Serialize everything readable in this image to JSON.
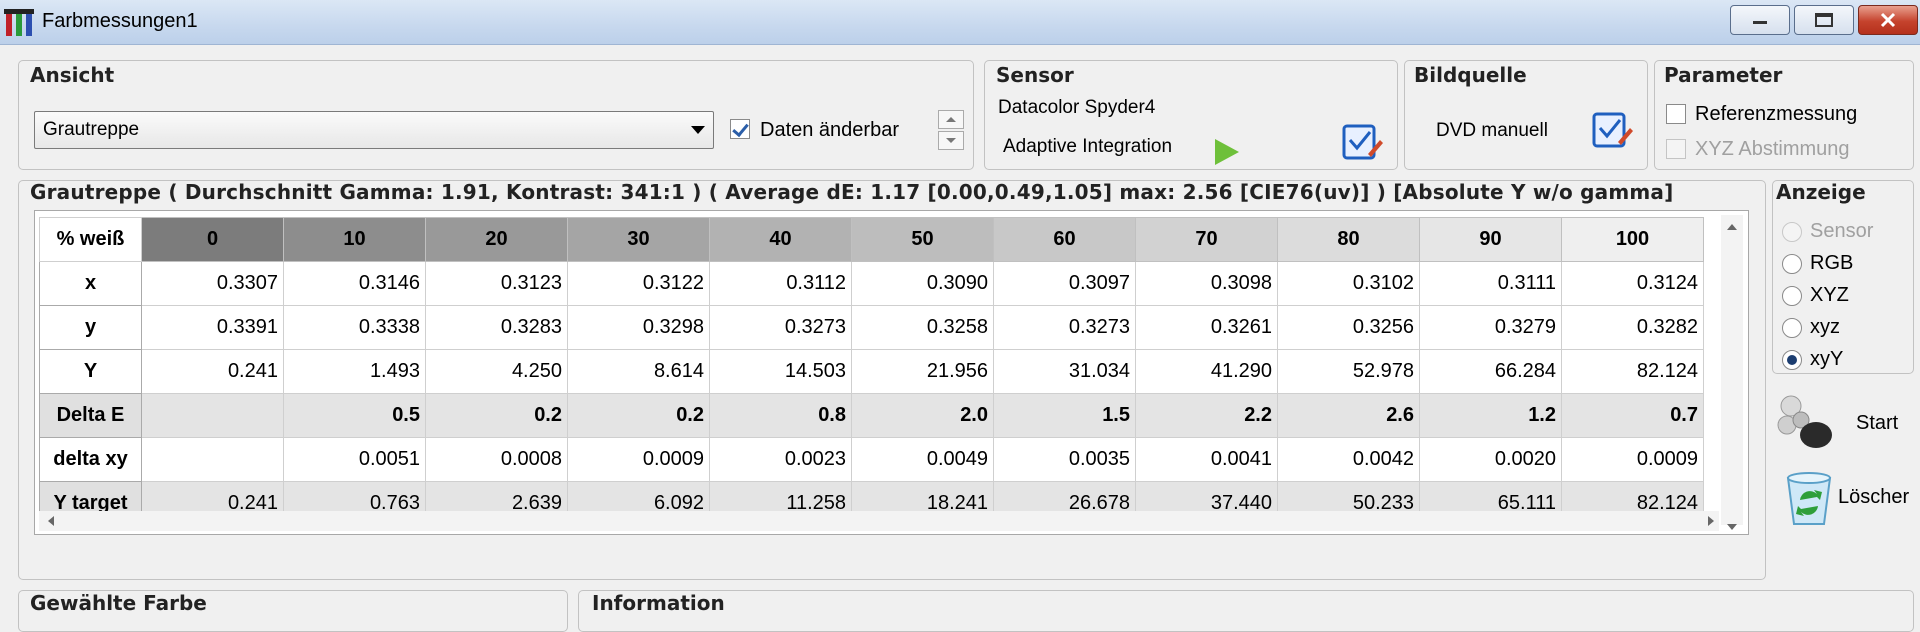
{
  "window": {
    "title": "Farbmessungen1"
  },
  "ansicht": {
    "title": "Ansicht",
    "combo_value": "Grautreppe",
    "checkbox_label": "Daten änderbar",
    "checkbox_checked": true
  },
  "sensor": {
    "title": "Sensor",
    "device": "Datacolor Spyder4",
    "mode": "Adaptive Integration"
  },
  "bildquelle": {
    "title": "Bildquelle",
    "source": "DVD manuell"
  },
  "parameter": {
    "title": "Parameter",
    "referenz_label": "Referenzmessung",
    "xyz_label": "XYZ Abstimmung"
  },
  "summary": {
    "text": "Grautreppe ( Durchschnitt Gamma: 1.91, Kontrast: 341:1 ) ( Average dE: 1.17 [0.00,0.49,1.05] max: 2.56 [CIE76(uv)] ) [Absolute Y w/o gamma]"
  },
  "anzeige": {
    "title": "Anzeige",
    "options": [
      "Sensor",
      "RGB",
      "XYZ",
      "xyz",
      "xyY"
    ],
    "selected": "xyY"
  },
  "actions": {
    "start_label": "Start",
    "loeschen_label": "Löscher"
  },
  "table": {
    "corner": "% weiß",
    "columns": [
      "0",
      "10",
      "20",
      "30",
      "40",
      "50",
      "60",
      "70",
      "80",
      "90",
      "100"
    ],
    "header_colors": [
      "#7c7c7c",
      "#8d8d8d",
      "#999999",
      "#a5a5a5",
      "#b2b2b2",
      "#bdbdbd",
      "#c8c8c8",
      "#d2d2d2",
      "#dcdcdc",
      "#e6e6e6",
      "#efefef"
    ],
    "rows": [
      {
        "label": "x",
        "values": [
          "0.3307",
          "0.3146",
          "0.3123",
          "0.3122",
          "0.3112",
          "0.3090",
          "0.3097",
          "0.3098",
          "0.3102",
          "0.3111",
          "0.3124"
        ]
      },
      {
        "label": "y",
        "values": [
          "0.3391",
          "0.3338",
          "0.3283",
          "0.3298",
          "0.3273",
          "0.3258",
          "0.3273",
          "0.3261",
          "0.3256",
          "0.3279",
          "0.3282"
        ]
      },
      {
        "label": "Y",
        "values": [
          "0.241",
          "1.493",
          "4.250",
          "8.614",
          "14.503",
          "21.956",
          "31.034",
          "41.290",
          "52.978",
          "66.284",
          "82.124"
        ]
      },
      {
        "label": "Delta E",
        "values": [
          "",
          "0.5",
          "0.2",
          "0.2",
          "0.8",
          "2.0",
          "1.5",
          "2.2",
          "2.6",
          "1.2",
          "0.7"
        ],
        "shade": true,
        "bold": true
      },
      {
        "label": "delta xy",
        "values": [
          "",
          "0.0051",
          "0.0008",
          "0.0009",
          "0.0023",
          "0.0049",
          "0.0035",
          "0.0041",
          "0.0042",
          "0.0020",
          "0.0009"
        ]
      },
      {
        "label": "Y target",
        "values": [
          "0.241",
          "0.763",
          "2.639",
          "6.092",
          "11.258",
          "18.241",
          "26.678",
          "37.440",
          "50.233",
          "65.111",
          "82.124"
        ],
        "shade": true
      }
    ]
  },
  "bottom": {
    "left_title": "Gewählte Farbe",
    "right_title": "Information"
  }
}
